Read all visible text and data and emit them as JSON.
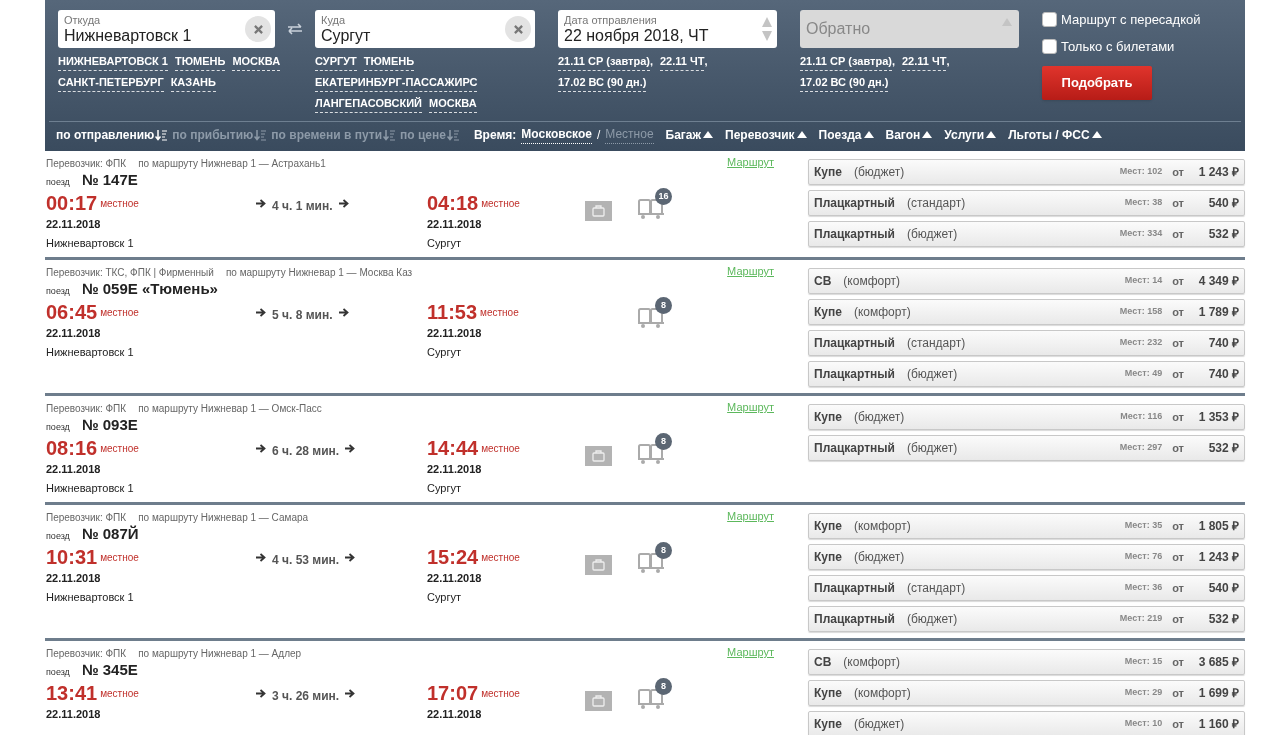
{
  "search": {
    "from": {
      "label": "Откуда",
      "value": "Нижневартовск 1"
    },
    "from_suggestions": [
      "НИЖНЕВАРТОВСК 1",
      "ТЮМЕНЬ",
      "МОСКВА",
      "САНКТ-ПЕТЕРБУРГ",
      "КАЗАНЬ"
    ],
    "to": {
      "label": "Куда",
      "value": "Сургут"
    },
    "to_suggestions": [
      "СУРГУТ",
      "ТЮМЕНЬ",
      "ЕКАТЕРИНБУРГ-ПАССАЖИРС",
      "ЛАНГЕПАСОВСКИЙ",
      "МОСКВА"
    ],
    "date": {
      "label": "Дата отправления",
      "value": "22 ноября 2018, ЧТ"
    },
    "date_suggestions": [
      "21.11 СР (завтра)",
      "22.11 ЧТ",
      "17.02 ВС (90 дн.)"
    ],
    "return": {
      "placeholder": "Обратно",
      "disabled": true
    },
    "return_suggestions": [
      "21.11 СР (завтра)",
      "22.11 ЧТ",
      "17.02 ВС (90 дн.)"
    ],
    "separator": ",",
    "checkboxes": [
      {
        "label": "Маршрут с пересадкой",
        "checked": false
      },
      {
        "label": "Только с билетами",
        "checked": false
      }
    ],
    "submit": "Подобрать"
  },
  "sort": {
    "items": [
      {
        "label": "по отправлению",
        "selected": true
      },
      {
        "label": "по прибытию",
        "selected": false
      },
      {
        "label": "по времени в пути",
        "selected": false
      },
      {
        "label": "по цене",
        "selected": false
      }
    ],
    "time_label": "Время:",
    "time_options": [
      {
        "label": "Московское",
        "selected": true
      },
      {
        "label": "Местное",
        "selected": false
      }
    ],
    "time_separator": "/",
    "filters": [
      "Багаж",
      "Перевозчик",
      "Поезда",
      "Вагон",
      "Услуги",
      "Льготы / ФСС"
    ]
  },
  "trains": [
    {
      "carrier": "Перевозчик: ФПК",
      "route": "по маршруту Нижневар 1 — Астрахань1",
      "route_link": "Маршрут",
      "train_label": "поезд",
      "number": "№ 147Е",
      "dep_time": "00:17",
      "dep_note": "местное",
      "duration": "4 ч. 1 мин.",
      "arr_time": "04:18",
      "arr_note": "местное",
      "dep_date": "22.11.2018",
      "arr_date": "22.11.2018",
      "dep_station": "Нижневартовск 1",
      "arr_station": "Сургут",
      "baggage": true,
      "cars_badge": "16",
      "tariffs": [
        {
          "type": "Купе",
          "class": "(бюджет)",
          "seats": "Мест: 102",
          "from": "от",
          "price": "1 243 ₽"
        },
        {
          "type": "Плацкартный",
          "class": "(стандарт)",
          "seats": "Мест: 38",
          "from": "от",
          "price": "540 ₽"
        },
        {
          "type": "Плацкартный",
          "class": "(бюджет)",
          "seats": "Мест: 334",
          "from": "от",
          "price": "532 ₽"
        }
      ]
    },
    {
      "carrier": "Перевозчик: ТКС, ФПК | Фирменный",
      "route": "по маршруту Нижневар 1 — Москва Каз",
      "route_link": "Маршрут",
      "train_label": "поезд",
      "number": "№ 059Е «Тюмень»",
      "dep_time": "06:45",
      "dep_note": "местное",
      "duration": "5 ч. 8 мин.",
      "arr_time": "11:53",
      "arr_note": "местное",
      "dep_date": "22.11.2018",
      "arr_date": "22.11.2018",
      "dep_station": "Нижневартовск 1",
      "arr_station": "Сургут",
      "baggage": false,
      "cars_badge": "8",
      "tariffs": [
        {
          "type": "СВ",
          "class": "(комфорт)",
          "seats": "Мест: 14",
          "from": "от",
          "price": "4 349 ₽"
        },
        {
          "type": "Купе",
          "class": "(комфорт)",
          "seats": "Мест: 158",
          "from": "от",
          "price": "1 789 ₽"
        },
        {
          "type": "Плацкартный",
          "class": "(стандарт)",
          "seats": "Мест: 232",
          "from": "от",
          "price": "740 ₽"
        },
        {
          "type": "Плацкартный",
          "class": "(бюджет)",
          "seats": "Мест: 49",
          "from": "от",
          "price": "740 ₽"
        }
      ]
    },
    {
      "carrier": "Перевозчик: ФПК",
      "route": "по маршруту Нижневар 1 — Омск-Пасс",
      "route_link": "Маршрут",
      "train_label": "поезд",
      "number": "№ 093Е",
      "dep_time": "08:16",
      "dep_note": "местное",
      "duration": "6 ч. 28 мин.",
      "arr_time": "14:44",
      "arr_note": "местное",
      "dep_date": "22.11.2018",
      "arr_date": "22.11.2018",
      "dep_station": "Нижневартовск 1",
      "arr_station": "Сургут",
      "baggage": true,
      "cars_badge": "8",
      "tariffs": [
        {
          "type": "Купе",
          "class": "(бюджет)",
          "seats": "Мест: 116",
          "from": "от",
          "price": "1 353 ₽"
        },
        {
          "type": "Плацкартный",
          "class": "(бюджет)",
          "seats": "Мест: 297",
          "from": "от",
          "price": "532 ₽"
        }
      ]
    },
    {
      "carrier": "Перевозчик: ФПК",
      "route": "по маршруту Нижневар 1 — Самара",
      "route_link": "Маршрут",
      "train_label": "поезд",
      "number": "№ 087Й",
      "dep_time": "10:31",
      "dep_note": "местное",
      "duration": "4 ч. 53 мин.",
      "arr_time": "15:24",
      "arr_note": "местное",
      "dep_date": "22.11.2018",
      "arr_date": "22.11.2018",
      "dep_station": "Нижневартовск 1",
      "arr_station": "Сургут",
      "baggage": true,
      "cars_badge": "8",
      "tariffs": [
        {
          "type": "Купе",
          "class": "(комфорт)",
          "seats": "Мест: 35",
          "from": "от",
          "price": "1 805 ₽"
        },
        {
          "type": "Купе",
          "class": "(бюджет)",
          "seats": "Мест: 76",
          "from": "от",
          "price": "1 243 ₽"
        },
        {
          "type": "Плацкартный",
          "class": "(стандарт)",
          "seats": "Мест: 36",
          "from": "от",
          "price": "540 ₽"
        },
        {
          "type": "Плацкартный",
          "class": "(бюджет)",
          "seats": "Мест: 219",
          "from": "от",
          "price": "532 ₽"
        }
      ]
    },
    {
      "carrier": "Перевозчик: ФПК",
      "route": "по маршруту Нижневар 1 — Адлер",
      "route_link": "Маршрут",
      "train_label": "поезд",
      "number": "№ 345Е",
      "dep_time": "13:41",
      "dep_note": "местное",
      "duration": "3 ч. 26 мин.",
      "arr_time": "17:07",
      "arr_note": "местное",
      "dep_date": "22.11.2018",
      "arr_date": "22.11.2018",
      "baggage": true,
      "cars_badge": "8",
      "tariffs": [
        {
          "type": "СВ",
          "class": "(комфорт)",
          "seats": "Мест: 15",
          "from": "от",
          "price": "3 685 ₽"
        },
        {
          "type": "Купе",
          "class": "(комфорт)",
          "seats": "Мест: 29",
          "from": "от",
          "price": "1 699 ₽"
        },
        {
          "type": "Купе",
          "class": "(бюджет)",
          "seats": "Мест: 10",
          "from": "от",
          "price": "1 160 ₽"
        }
      ]
    }
  ]
}
